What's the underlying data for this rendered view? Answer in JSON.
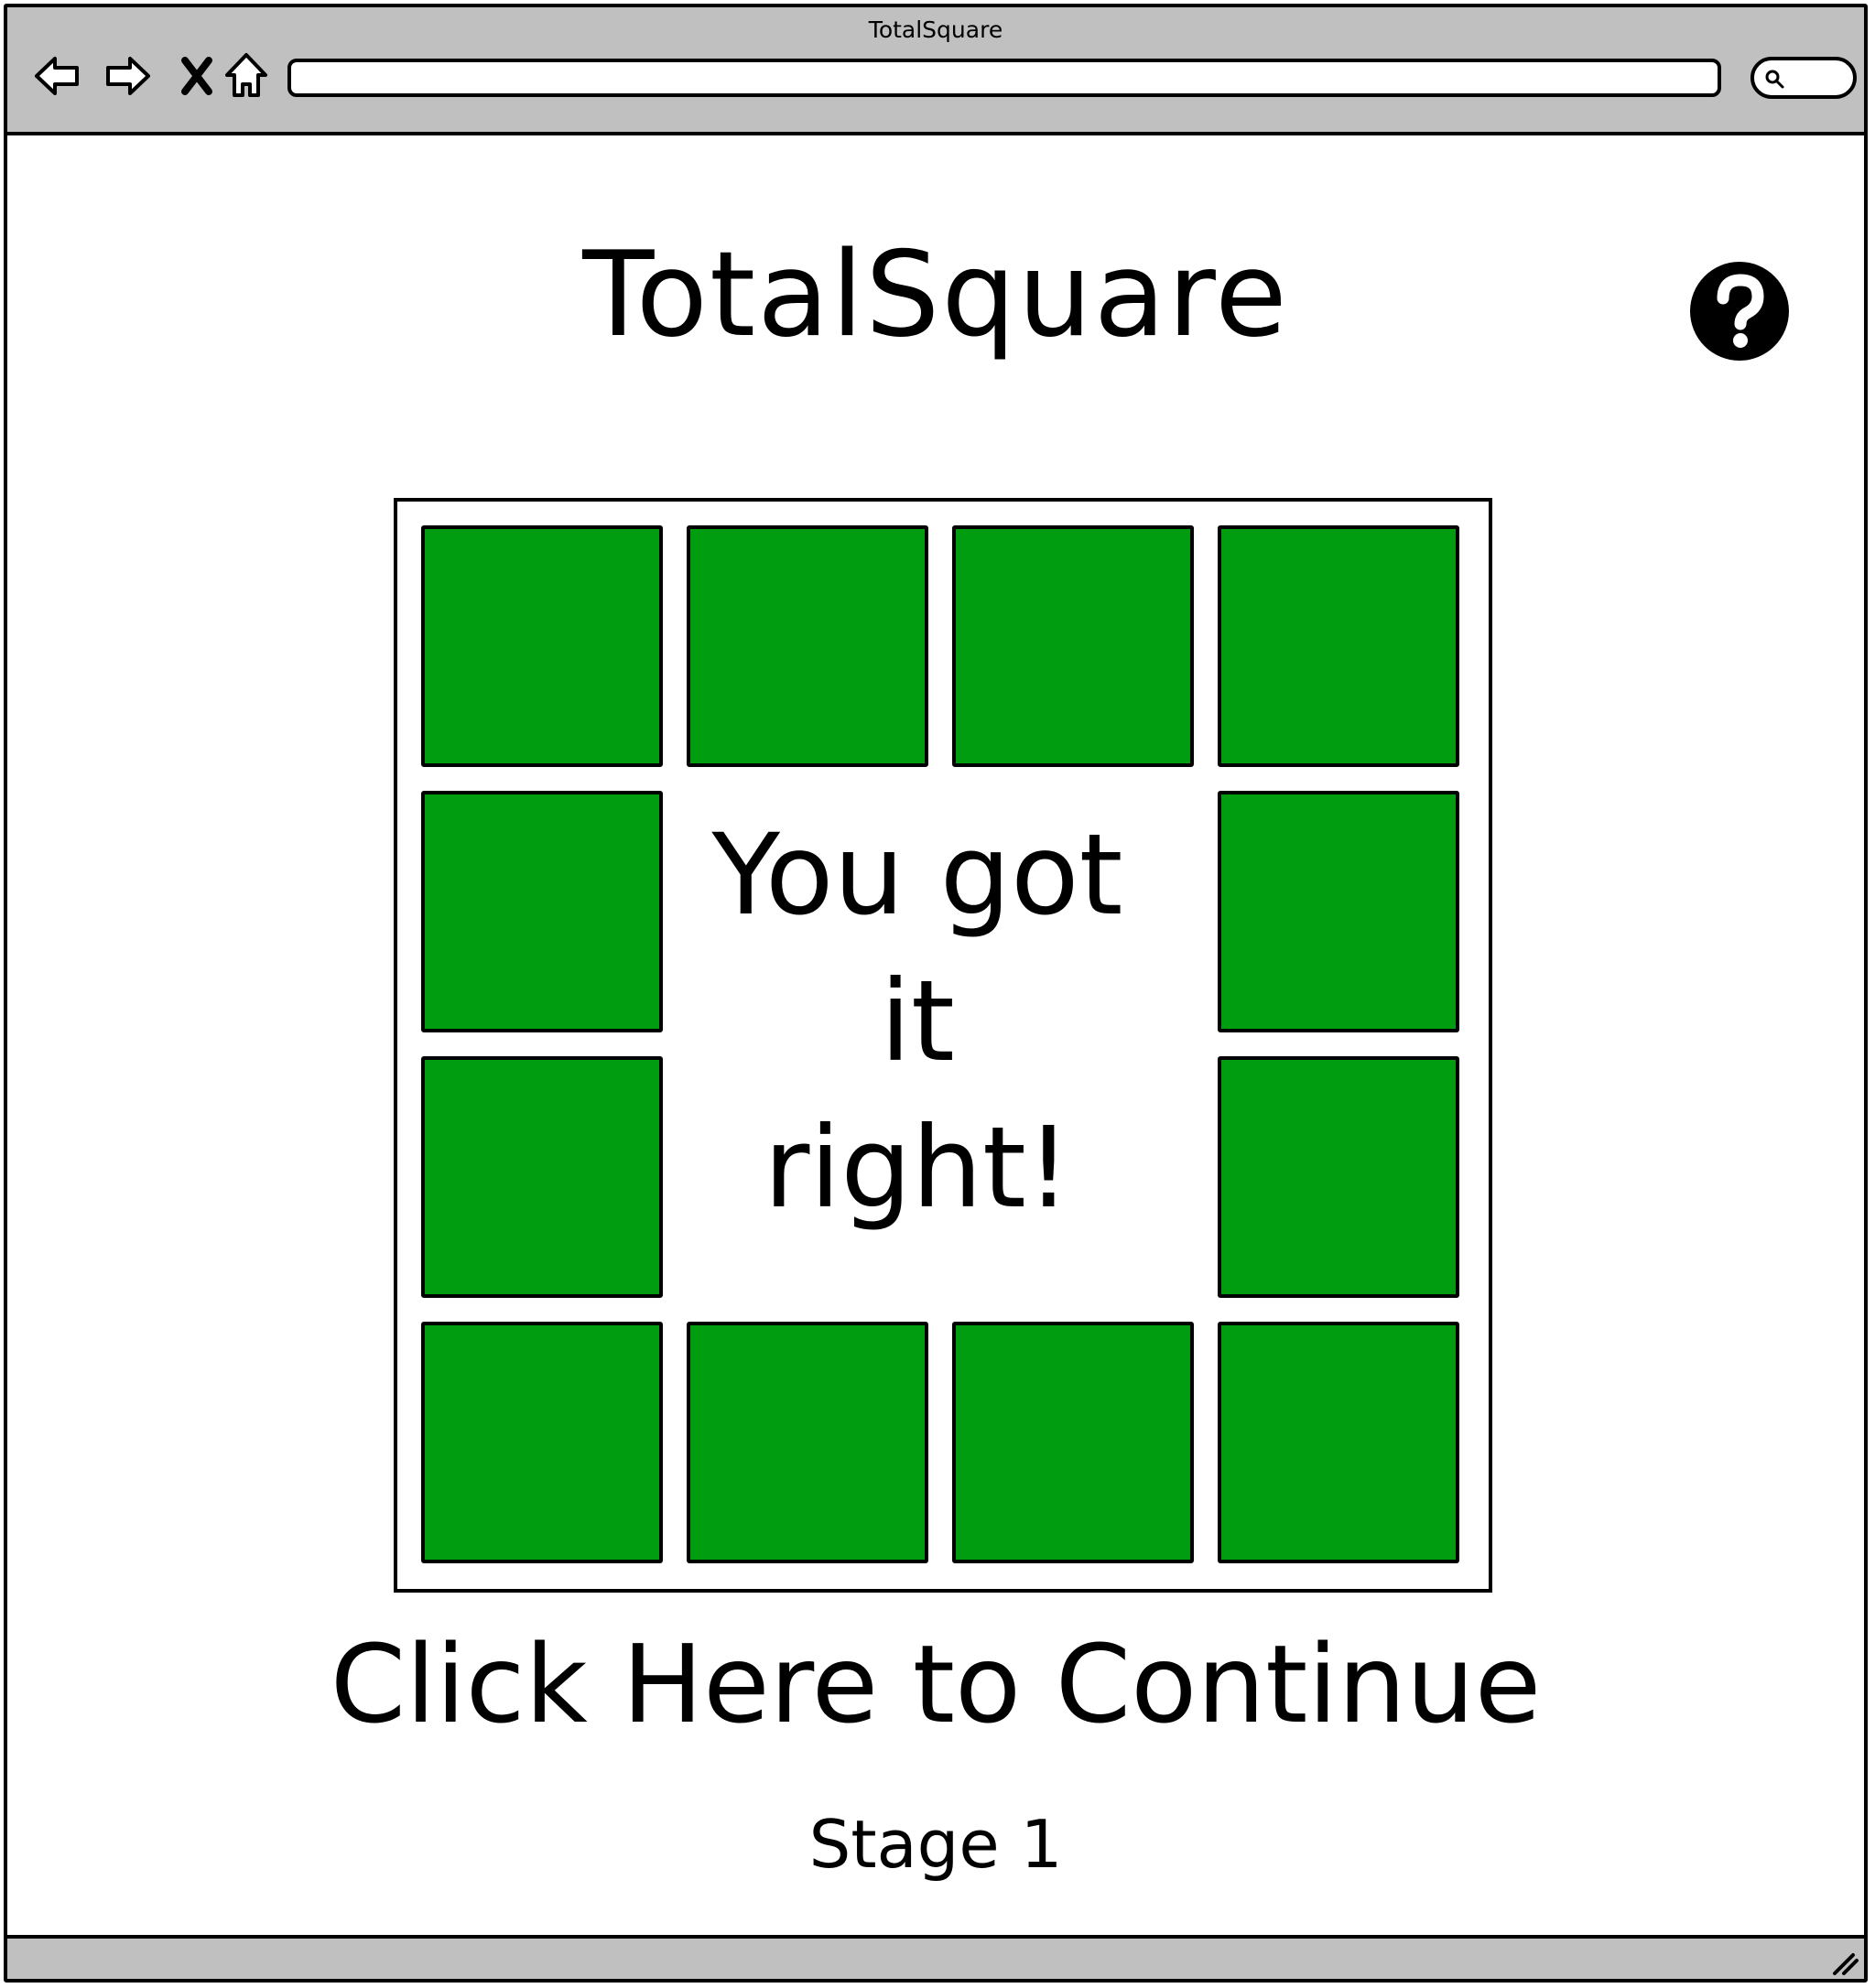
{
  "window": {
    "title": "TotalSquare"
  },
  "browser": {
    "icons": [
      "back-arrow-icon",
      "forward-arrow-icon",
      "close-icon",
      "home-icon",
      "search-icon"
    ],
    "address_value": ""
  },
  "page": {
    "title": "TotalSquare",
    "help_icon": "question-mark-icon",
    "result_lines": [
      "You got",
      "it",
      "right!"
    ],
    "continue_label": "Click Here to Continue",
    "stage_label": "Stage 1"
  },
  "board": {
    "rows": 4,
    "cols": 4,
    "tile_color": "#019d10",
    "filled_tiles": [
      "r1c1",
      "r1c2",
      "r1c3",
      "r1c4",
      "r2c1",
      "r2c4",
      "r3c1",
      "r3c4",
      "r4c1",
      "r4c2",
      "r4c3",
      "r4c4"
    ]
  }
}
